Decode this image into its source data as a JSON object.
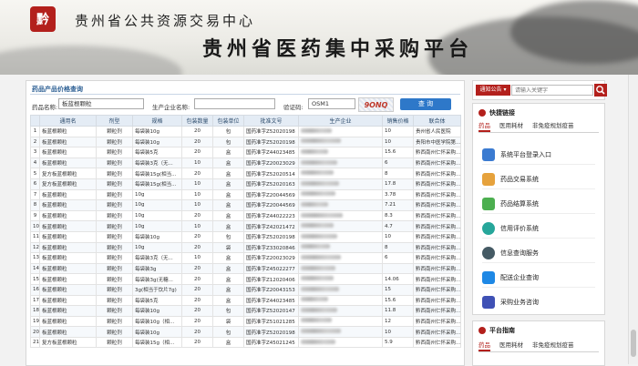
{
  "header": {
    "seal_char": "黔",
    "org_title": "贵州省公共资源交易中心",
    "platform_title": "贵州省医药集中采购平台"
  },
  "panel": {
    "title": "药品产品价格查询",
    "filters": {
      "drug_name_label": "药品名称:",
      "drug_name_value": "板蓝根颗粒",
      "company_label": "生产企业名称:",
      "company_value": "",
      "captcha_label": "验证码:",
      "captcha_value": "OSM1",
      "captcha_image_text": "9ONQ",
      "query_label": "查 询"
    },
    "columns": [
      "",
      "通用名",
      "剂型",
      "规格",
      "包装数量",
      "包装单位",
      "批准文号",
      "生产企业",
      "销售价格",
      "联合体"
    ],
    "rows": [
      {
        "n": "1",
        "name": "板蓝根颗粒",
        "form": "颗粒剂",
        "spec": "每袋装10g",
        "qty": "20",
        "unit": "包",
        "approval": "国药准字Z52020198",
        "price": "10",
        "union": "贵州省人民医院"
      },
      {
        "n": "2",
        "name": "板蓝根颗粒",
        "form": "颗粒剂",
        "spec": "每袋装10g",
        "qty": "20",
        "unit": "包",
        "approval": "国药准字Z52020198",
        "price": "10",
        "union": "贵阳市中医学院第..."
      },
      {
        "n": "3",
        "name": "板蓝根颗粒",
        "form": "颗粒剂",
        "spec": "每袋装5克",
        "qty": "20",
        "unit": "盒",
        "approval": "国药准字Z44023485",
        "price": "15.6",
        "union": "黔西南州仁怀采购..."
      },
      {
        "n": "4",
        "name": "板蓝根颗粒",
        "form": "颗粒剂",
        "spec": "每袋装3克（无...",
        "qty": "10",
        "unit": "盒",
        "approval": "国药准字Z20023029",
        "price": "6",
        "union": "黔西南州仁怀采购..."
      },
      {
        "n": "5",
        "name": "复方板蓝根颗粒",
        "form": "颗粒剂",
        "spec": "每袋装15g(相当...",
        "qty": "20",
        "unit": "盒",
        "approval": "国药准字Z52020514",
        "price": "8",
        "union": "黔西南州仁怀采购..."
      },
      {
        "n": "6",
        "name": "复方板蓝根颗粒",
        "form": "颗粒剂",
        "spec": "每袋装15g(相当...",
        "qty": "10",
        "unit": "盒",
        "approval": "国药准字Z52020163",
        "price": "17.8",
        "union": "黔西南州仁怀采购..."
      },
      {
        "n": "7",
        "name": "板蓝根颗粒",
        "form": "颗粒剂",
        "spec": "10g",
        "qty": "10",
        "unit": "盒",
        "approval": "国药准字Z20044569",
        "price": "3.78",
        "union": "黔西南州仁怀采购..."
      },
      {
        "n": "8",
        "name": "板蓝根颗粒",
        "form": "颗粒剂",
        "spec": "10g",
        "qty": "10",
        "unit": "盒",
        "approval": "国药准字Z20044569",
        "price": "7.21",
        "union": "黔西南州仁怀采购..."
      },
      {
        "n": "9",
        "name": "板蓝根颗粒",
        "form": "颗粒剂",
        "spec": "10g",
        "qty": "20",
        "unit": "盒",
        "approval": "国药准字Z44022223",
        "price": "8.3",
        "union": "黔西南州仁怀采购..."
      },
      {
        "n": "10",
        "name": "板蓝根颗粒",
        "form": "颗粒剂",
        "spec": "10g",
        "qty": "10",
        "unit": "盒",
        "approval": "国药准字Z42021472",
        "price": "4.7",
        "union": "黔西南州仁怀采购..."
      },
      {
        "n": "11",
        "name": "板蓝根颗粒",
        "form": "颗粒剂",
        "spec": "每袋装10g",
        "qty": "20",
        "unit": "包",
        "approval": "国药准字Z52020198",
        "price": "10",
        "union": "黔西南州仁怀采购..."
      },
      {
        "n": "12",
        "name": "板蓝根颗粒",
        "form": "颗粒剂",
        "spec": "10g",
        "qty": "20",
        "unit": "袋",
        "approval": "国药准字Z33020846",
        "price": "8",
        "union": "黔西南州仁怀采购..."
      },
      {
        "n": "13",
        "name": "板蓝根颗粒",
        "form": "颗粒剂",
        "spec": "每袋装3克（无...",
        "qty": "10",
        "unit": "盒",
        "approval": "国药准字Z20023029",
        "price": "6",
        "union": "黔西南州仁怀采购..."
      },
      {
        "n": "14",
        "name": "板蓝根颗粒",
        "form": "颗粒剂",
        "spec": "每袋装3g",
        "qty": "20",
        "unit": "盒",
        "approval": "国药准字Z45022277",
        "price": "",
        "union": "黔西南州仁怀采购..."
      },
      {
        "n": "15",
        "name": "板蓝根颗粒",
        "form": "颗粒剂",
        "spec": "每袋装3g(无糖...",
        "qty": "20",
        "unit": "盒",
        "approval": "国药准字Z12020406",
        "price": "14.06",
        "union": "黔西南州仁怀采购..."
      },
      {
        "n": "16",
        "name": "板蓝根颗粒",
        "form": "颗粒剂",
        "spec": "3g(相当于饮片7g)",
        "qty": "20",
        "unit": "盒",
        "approval": "国药准字Z20043153",
        "price": "15",
        "union": "黔西南州仁怀采购..."
      },
      {
        "n": "17",
        "name": "板蓝根颗粒",
        "form": "颗粒剂",
        "spec": "每袋装5克",
        "qty": "20",
        "unit": "盒",
        "approval": "国药准字Z44023485",
        "price": "15.6",
        "union": "黔西南州仁怀采购..."
      },
      {
        "n": "18",
        "name": "板蓝根颗粒",
        "form": "颗粒剂",
        "spec": "每袋装10g",
        "qty": "20",
        "unit": "包",
        "approval": "国药准字Z52020147",
        "price": "11.8",
        "union": "黔西南州仁怀采购..."
      },
      {
        "n": "19",
        "name": "板蓝根颗粒",
        "form": "颗粒剂",
        "spec": "每袋装10g（相...",
        "qty": "20",
        "unit": "袋",
        "approval": "国药准字Z51021285",
        "price": "12",
        "union": "黔西南州仁怀采购..."
      },
      {
        "n": "20",
        "name": "板蓝根颗粒",
        "form": "颗粒剂",
        "spec": "每袋装10g",
        "qty": "20",
        "unit": "包",
        "approval": "国药准字Z52020198",
        "price": "10",
        "union": "黔西南州仁怀采购..."
      },
      {
        "n": "21",
        "name": "复方板蓝根颗粒",
        "form": "颗粒剂",
        "spec": "每袋装15g（相...",
        "qty": "20",
        "unit": "盒",
        "approval": "国药准字Z45021245",
        "price": "5.9",
        "union": "黔西南州仁怀采购..."
      }
    ]
  },
  "sidebar": {
    "notice_select": "通知公告 ▾",
    "search_placeholder": "请输入关键字",
    "quick": {
      "title": "快捷链接",
      "tabs": [
        "药品",
        "医用耗材",
        "非免疫规划疫苗"
      ],
      "links": [
        "系统平台登录入口",
        "药品交易系统",
        "药品结算系统",
        "信用评价系统",
        "信息查询服务",
        "配送企业查询",
        "采购业务咨询"
      ]
    },
    "guide": {
      "title": "平台指南",
      "tabs": [
        "药品",
        "医用耗材",
        "非免疫规划疫苗"
      ]
    }
  },
  "colors": {
    "brand_red": "#b3201c",
    "query_blue": "#2e78c9",
    "header_blue": "#2b5e93"
  }
}
